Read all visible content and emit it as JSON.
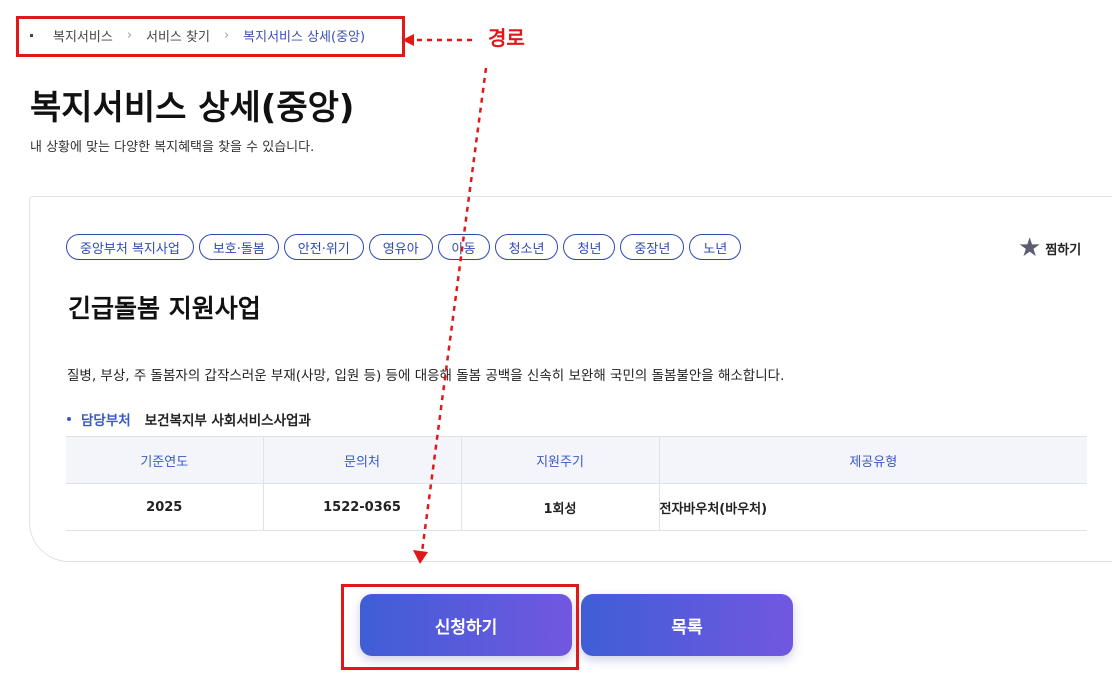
{
  "breadcrumb": {
    "items": [
      "복지서비스",
      "서비스 찾기",
      "복지서비스 상세(중앙)"
    ],
    "separator": ">"
  },
  "annotation": {
    "label": "경로",
    "color": "#e01818"
  },
  "header": {
    "title": "복지서비스 상세(중앙)",
    "description": "내 상황에 맞는 다양한 복지혜택을 찾을 수 있습니다."
  },
  "service": {
    "tags": [
      "중앙부처 복지사업",
      "보호·돌봄",
      "안전·위기",
      "영유아",
      "아동",
      "청소년",
      "청년",
      "중장년",
      "노년"
    ],
    "favorite_label": "찜하기",
    "title": "긴급돌봄 지원사업",
    "description": "질병, 부상, 주 돌봄자의 갑작스러운 부재(사망, 입원 등) 등에 대응해 돌봄 공백을 신속히 보완해 국민의 돌봄불안을 해소합니다.",
    "department_label": "담당부처",
    "department_value": "보건복지부 사회서비스사업과",
    "table": {
      "headers": [
        "기준연도",
        "문의처",
        "지원주기",
        "제공유형"
      ],
      "row": [
        "2025",
        "1522-0365",
        "1회성",
        "전자바우처(바우처)"
      ]
    }
  },
  "actions": {
    "apply_label": "신청하기",
    "list_label": "목록"
  },
  "colors": {
    "accent": "#2f4ab3",
    "button_start": "#3f5ed6",
    "button_end": "#7257e0"
  }
}
